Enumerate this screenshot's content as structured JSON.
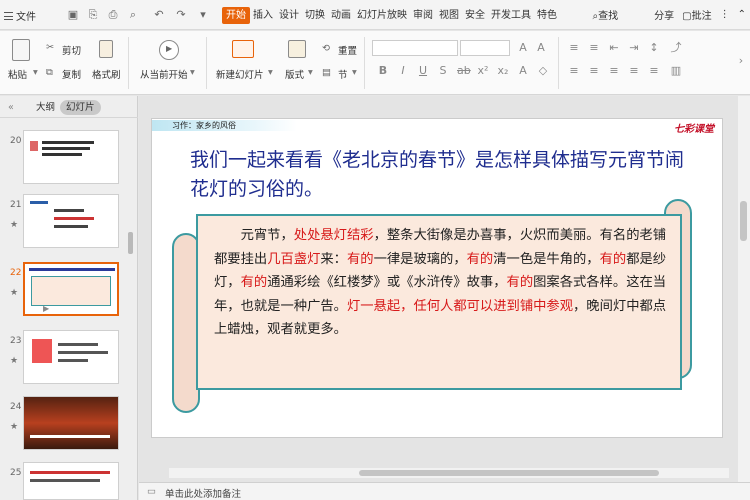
{
  "menubar": {
    "file_label": "文件",
    "tabs": [
      "开始",
      "插入",
      "设计",
      "切换",
      "动画",
      "幻灯片放映",
      "审阅",
      "视图",
      "安全",
      "开发工具",
      "特色"
    ],
    "active_tab": "开始",
    "search_label": "查找",
    "share_label": "分享",
    "comment_label": "批注"
  },
  "ribbon": {
    "paste": "粘贴",
    "cut": "剪切",
    "copy": "复制",
    "format_painter": "格式刷",
    "from_current": "从当前开始",
    "new_slide": "新建幻灯片",
    "layout": "版式",
    "reset": "重置",
    "section": "节"
  },
  "panel": {
    "tab_outline": "大纲",
    "tab_slides": "幻灯片",
    "slide_numbers": [
      "20",
      "21",
      "22",
      "23",
      "24",
      "25"
    ]
  },
  "slide": {
    "header_tag": "习作：家乡的风俗",
    "logo": "七彩课堂",
    "headline": "我们一起来看看《老北京的春节》是怎样具体描写元宵节闹花灯的习俗的。",
    "para": [
      {
        "t": "　　元宵节，",
        "r": false
      },
      {
        "t": "处处悬灯结彩",
        "r": true
      },
      {
        "t": "，整条大街像是办喜事，火炽而美丽。有名的老铺都要挂出",
        "r": false
      },
      {
        "t": "几百盏灯",
        "r": true
      },
      {
        "t": "来：",
        "r": false
      },
      {
        "t": "有的",
        "r": true
      },
      {
        "t": "一律是玻璃的，",
        "r": false
      },
      {
        "t": "有的",
        "r": true
      },
      {
        "t": "清一色是牛角的，",
        "r": false
      },
      {
        "t": "有的",
        "r": true
      },
      {
        "t": "都是纱灯，",
        "r": false
      },
      {
        "t": "有的",
        "r": true
      },
      {
        "t": "通通彩绘《红楼梦》或《水浒传》故事，",
        "r": false
      },
      {
        "t": "有的",
        "r": true
      },
      {
        "t": "图案各式各样。这在当年，也就是一种广告。",
        "r": false
      },
      {
        "t": "灯一悬起，任何人都可以进到铺中参观",
        "r": true
      },
      {
        "t": "，晚间灯中都点上蜡烛，观者就更多。",
        "r": false
      }
    ]
  },
  "notes": {
    "placeholder": "单击此处添加备注"
  },
  "colors": {
    "accent": "#e8630a",
    "headline": "#1f2d8f",
    "emphasis": "#d71a1a",
    "scroll_border": "#3c9aa0",
    "paper": "#fbe9dd"
  }
}
